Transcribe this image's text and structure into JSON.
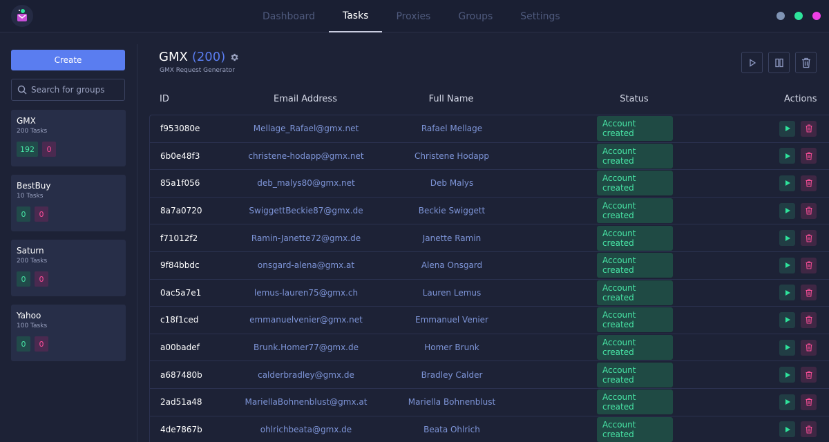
{
  "nav": {
    "tabs": [
      {
        "label": "Dashboard",
        "active": false
      },
      {
        "label": "Tasks",
        "active": true
      },
      {
        "label": "Proxies",
        "active": false
      },
      {
        "label": "Groups",
        "active": false
      },
      {
        "label": "Settings",
        "active": false
      }
    ]
  },
  "window_dots": [
    "#7f93b4",
    "#2ee39b",
    "#ef3fe6"
  ],
  "sidebar": {
    "create_label": "Create",
    "search_placeholder": "Search for groups",
    "groups": [
      {
        "name": "GMX",
        "count": "200 Tasks",
        "success": "192",
        "failed": "0"
      },
      {
        "name": "BestBuy",
        "count": "10 Tasks",
        "success": "0",
        "failed": "0"
      },
      {
        "name": "Saturn",
        "count": "200 Tasks",
        "success": "0",
        "failed": "0"
      },
      {
        "name": "Yahoo",
        "count": "100 Tasks",
        "success": "0",
        "failed": "0"
      }
    ]
  },
  "main": {
    "title": "GMX",
    "title_count": "(200)",
    "subtitle": "GMX Request Generator",
    "columns": {
      "id": "ID",
      "email": "Email Address",
      "name": "Full Name",
      "status": "Status",
      "actions": "Actions"
    },
    "rows": [
      {
        "id": "f953080e",
        "email": "Mellage_Rafael@gmx.net",
        "name": "Rafael Mellage",
        "status": "Account created"
      },
      {
        "id": "6b0e48f3",
        "email": "christene-hodapp@gmx.net",
        "name": "Christene Hodapp",
        "status": "Account created"
      },
      {
        "id": "85a1f056",
        "email": "deb_malys80@gmx.net",
        "name": "Deb Malys",
        "status": "Account created"
      },
      {
        "id": "8a7a0720",
        "email": "SwiggettBeckie87@gmx.de",
        "name": "Beckie Swiggett",
        "status": "Account created"
      },
      {
        "id": "f71012f2",
        "email": "Ramin-Janette72@gmx.de",
        "name": "Janette Ramin",
        "status": "Account created"
      },
      {
        "id": "9f84bbdc",
        "email": "onsgard-alena@gmx.at",
        "name": "Alena Onsgard",
        "status": "Account created"
      },
      {
        "id": "0ac5a7e1",
        "email": "lemus-lauren75@gmx.ch",
        "name": "Lauren Lemus",
        "status": "Account created"
      },
      {
        "id": "c18f1ced",
        "email": "emmanuelvenier@gmx.net",
        "name": "Emmanuel Venier",
        "status": "Account created"
      },
      {
        "id": "a00badef",
        "email": "Brunk.Homer77@gmx.de",
        "name": "Homer Brunk",
        "status": "Account created"
      },
      {
        "id": "a687480b",
        "email": "calderbradley@gmx.de",
        "name": "Bradley Calder",
        "status": "Account created"
      },
      {
        "id": "2ad51a48",
        "email": "MariellaBohnenblust@gmx.at",
        "name": "Mariella Bohnenblust",
        "status": "Account created"
      },
      {
        "id": "4de7867b",
        "email": "ohlrichbeata@gmx.de",
        "name": "Beata Ohlrich",
        "status": "Account created"
      }
    ]
  }
}
